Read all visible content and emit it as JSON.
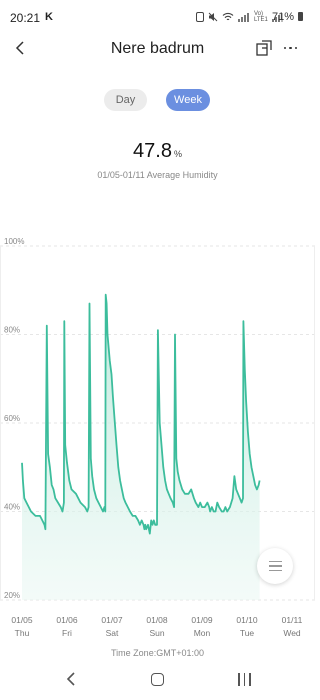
{
  "status_bar": {
    "time": "20:21",
    "carrier_letter": "K",
    "lte_text": "Vo) LTE1",
    "battery_percent": "71%"
  },
  "header": {
    "title": "Nere badrum",
    "back_icon": "chevron-left-icon",
    "share_icon": "export-icon",
    "more_icon": "more-dots-icon"
  },
  "range_tabs": {
    "day_label": "Day",
    "week_label": "Week",
    "selected": "Week"
  },
  "summary": {
    "value": "47.8",
    "unit": "%",
    "caption": "01/05-01/11 Average Humidity"
  },
  "timezone": "Time Zone:GMT+01:00",
  "colors": {
    "accent": "#6b8fe0",
    "line": "#3cbd9c",
    "fill_top": "#b8e8da"
  },
  "chart_data": {
    "type": "area",
    "ylabel": "",
    "xlabel": "",
    "ylim": [
      20,
      100
    ],
    "y_ticks": [
      "100%",
      "80%",
      "60%",
      "40%",
      "20%"
    ],
    "x_ticks": [
      {
        "date": "01/05",
        "day": "Thu"
      },
      {
        "date": "01/06",
        "day": "Fri"
      },
      {
        "date": "01/07",
        "day": "Sat"
      },
      {
        "date": "01/08",
        "day": "Sun"
      },
      {
        "date": "01/09",
        "day": "Mon"
      },
      {
        "date": "01/10",
        "day": "Tue"
      },
      {
        "date": "01/11",
        "day": "Wed"
      }
    ],
    "x_start_date": "01/05",
    "series": [
      {
        "points": [
          [
            0.0,
            51
          ],
          [
            0.02,
            47
          ],
          [
            0.05,
            43
          ],
          [
            0.1,
            42
          ],
          [
            0.15,
            41
          ],
          [
            0.2,
            40
          ],
          [
            0.3,
            39
          ],
          [
            0.4,
            39
          ],
          [
            0.45,
            38
          ],
          [
            0.5,
            37
          ],
          [
            0.52,
            36
          ],
          [
            0.55,
            82
          ],
          [
            0.58,
            53
          ],
          [
            0.62,
            50
          ],
          [
            0.66,
            46
          ],
          [
            0.7,
            45
          ],
          [
            0.74,
            43
          ],
          [
            0.8,
            42
          ],
          [
            0.86,
            41
          ],
          [
            0.9,
            40
          ],
          [
            0.93,
            42
          ],
          [
            0.94,
            83
          ],
          [
            0.96,
            55
          ],
          [
            1.0,
            51
          ],
          [
            1.05,
            47
          ],
          [
            1.1,
            45
          ],
          [
            1.2,
            44
          ],
          [
            1.3,
            42
          ],
          [
            1.4,
            41
          ],
          [
            1.45,
            40
          ],
          [
            1.48,
            41
          ],
          [
            1.5,
            87
          ],
          [
            1.53,
            52
          ],
          [
            1.56,
            48
          ],
          [
            1.6,
            45
          ],
          [
            1.65,
            43
          ],
          [
            1.7,
            42
          ],
          [
            1.75,
            41
          ],
          [
            1.8,
            40
          ],
          [
            1.83,
            41
          ],
          [
            1.85,
            40
          ],
          [
            1.86,
            89
          ],
          [
            1.88,
            87
          ],
          [
            1.9,
            80
          ],
          [
            1.95,
            74
          ],
          [
            1.99,
            71
          ],
          [
            2.02,
            66
          ],
          [
            2.05,
            62
          ],
          [
            2.1,
            55
          ],
          [
            2.14,
            50
          ],
          [
            2.18,
            47
          ],
          [
            2.22,
            45
          ],
          [
            2.26,
            43
          ],
          [
            2.3,
            42
          ],
          [
            2.35,
            41
          ],
          [
            2.4,
            40
          ],
          [
            2.46,
            39
          ],
          [
            2.52,
            39
          ],
          [
            2.58,
            38
          ],
          [
            2.62,
            37
          ],
          [
            2.66,
            38
          ],
          [
            2.7,
            37
          ],
          [
            2.72,
            36
          ],
          [
            2.74,
            37
          ],
          [
            2.76,
            36
          ],
          [
            2.8,
            37
          ],
          [
            2.84,
            35
          ],
          [
            2.87,
            38
          ],
          [
            2.9,
            37
          ],
          [
            2.93,
            38
          ],
          [
            2.96,
            37
          ],
          [
            3.0,
            37
          ],
          [
            3.02,
            81
          ],
          [
            3.06,
            60
          ],
          [
            3.1,
            55
          ],
          [
            3.14,
            50
          ],
          [
            3.18,
            47
          ],
          [
            3.22,
            45
          ],
          [
            3.26,
            44
          ],
          [
            3.3,
            43
          ],
          [
            3.35,
            42
          ],
          [
            3.38,
            41
          ],
          [
            3.4,
            80
          ],
          [
            3.43,
            52
          ],
          [
            3.46,
            49
          ],
          [
            3.5,
            47
          ],
          [
            3.56,
            45
          ],
          [
            3.62,
            44
          ],
          [
            3.7,
            44
          ],
          [
            3.76,
            45
          ],
          [
            3.82,
            43
          ],
          [
            3.86,
            42
          ],
          [
            3.92,
            41
          ],
          [
            3.96,
            42
          ],
          [
            4.0,
            41
          ],
          [
            4.06,
            41
          ],
          [
            4.12,
            42
          ],
          [
            4.16,
            41
          ],
          [
            4.18,
            40
          ],
          [
            4.22,
            41
          ],
          [
            4.26,
            40
          ],
          [
            4.3,
            40
          ],
          [
            4.34,
            42
          ],
          [
            4.38,
            41
          ],
          [
            4.44,
            40
          ],
          [
            4.48,
            40
          ],
          [
            4.52,
            41
          ],
          [
            4.56,
            40
          ],
          [
            4.62,
            41
          ],
          [
            4.68,
            43
          ],
          [
            4.72,
            48
          ],
          [
            4.76,
            45
          ],
          [
            4.8,
            44
          ],
          [
            4.84,
            43
          ],
          [
            4.88,
            42
          ],
          [
            4.91,
            43
          ],
          [
            4.92,
            83
          ],
          [
            4.95,
            72
          ],
          [
            4.98,
            65
          ],
          [
            5.02,
            58
          ],
          [
            5.06,
            53
          ],
          [
            5.1,
            50
          ],
          [
            5.14,
            48
          ],
          [
            5.18,
            46
          ],
          [
            5.22,
            45
          ],
          [
            5.26,
            46
          ],
          [
            5.28,
            47
          ]
        ]
      }
    ]
  }
}
